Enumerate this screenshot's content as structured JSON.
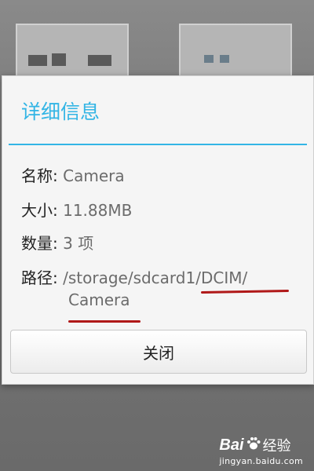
{
  "dialog": {
    "title": "详细信息",
    "rows": [
      {
        "label": "名称:",
        "value": "Camera"
      },
      {
        "label": "大小:",
        "value": "11.88MB"
      },
      {
        "label": "数量:",
        "value": "3 项"
      },
      {
        "label": "路径:",
        "value_line1": "/storage/sdcard1/DCIM/",
        "value_line2": "Camera"
      }
    ],
    "close_label": "关闭",
    "accent_color": "#33b5e5",
    "annotation_color": "#b01818"
  },
  "watermark": {
    "logo_bai": "Bai",
    "logo_suffix": "经验",
    "url": "jingyan.baidu.com",
    "paw_icon": "paw-icon"
  }
}
